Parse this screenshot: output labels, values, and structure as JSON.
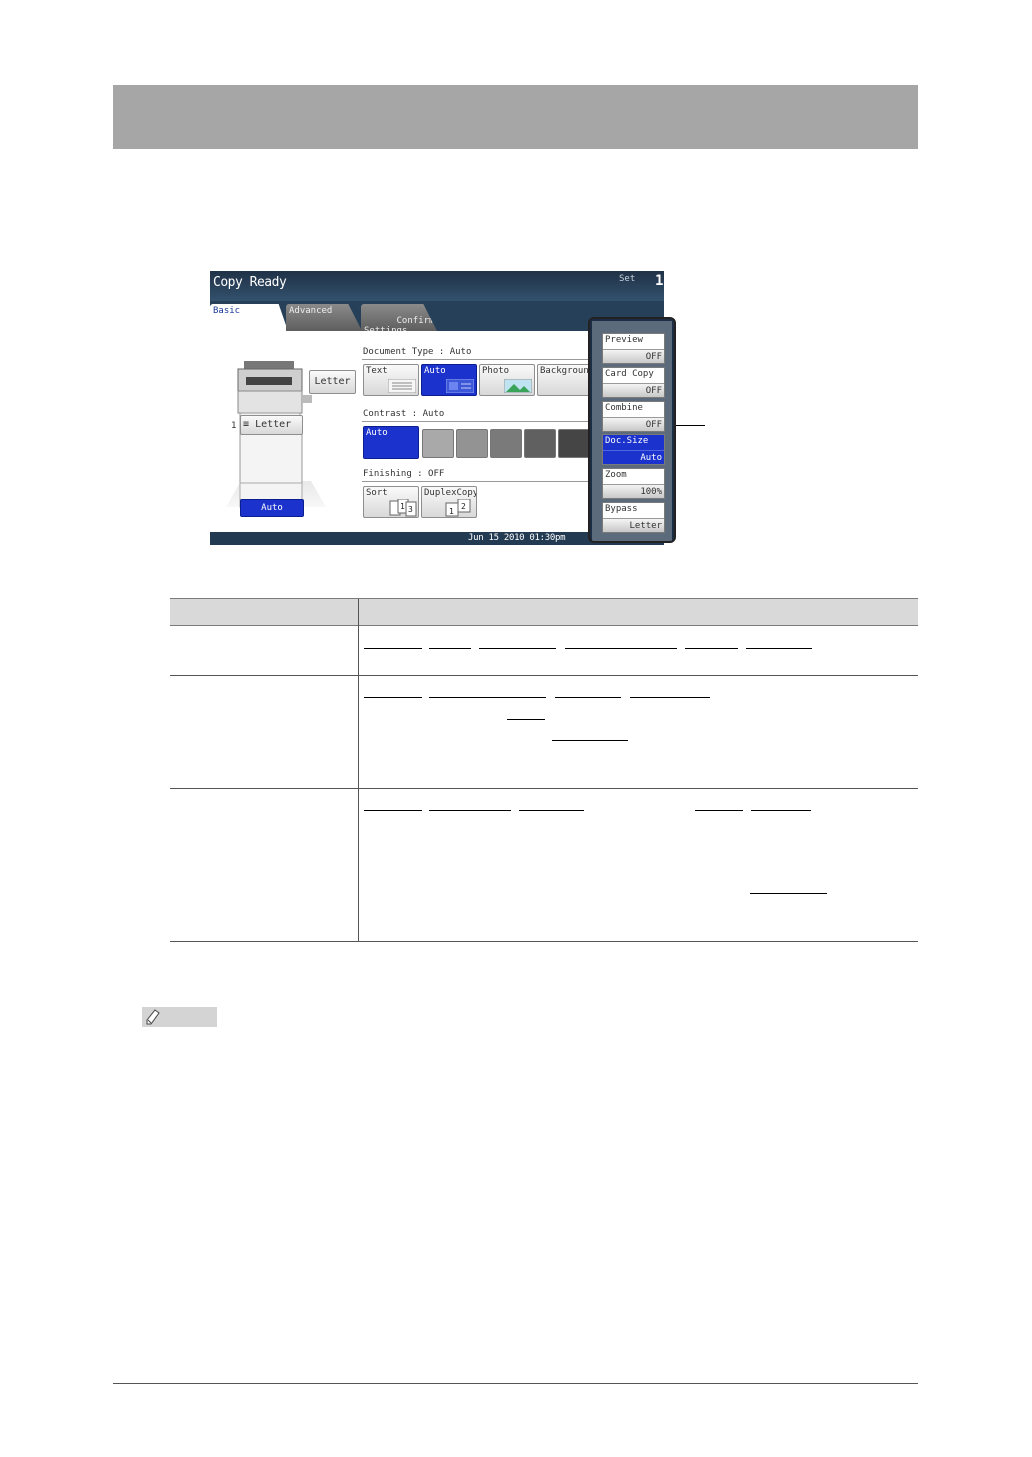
{
  "screen": {
    "title": "Copy Ready",
    "set_label": "Set",
    "set_count": "1",
    "tabs": [
      {
        "label": "Basic"
      },
      {
        "label": "Advanced"
      },
      {
        "label": "Confirm\nSettings"
      }
    ],
    "paper_tray_label": "Letter",
    "tray1_number": "1",
    "tray1_label": "Letter",
    "auto_button": "Auto",
    "document_type": {
      "label": "Document Type : Auto",
      "options": [
        "Text",
        "Auto",
        "Photo",
        "Background"
      ],
      "selected": "Auto"
    },
    "contrast": {
      "label": "Contrast     : Auto",
      "auto_label": "Auto",
      "levels": 5
    },
    "finishing": {
      "label": "Finishing    : OFF",
      "options": [
        "Sort",
        "DuplexCopy"
      ]
    },
    "side_panel": [
      {
        "name": "Preview",
        "value": "OFF",
        "selected": false
      },
      {
        "name": "Card Copy",
        "value": "OFF",
        "selected": false
      },
      {
        "name": "Combine",
        "value": "OFF",
        "selected": false
      },
      {
        "name": "Doc.Size",
        "value": "Auto",
        "selected": true
      },
      {
        "name": "Zoom",
        "value": "100%",
        "selected": false
      },
      {
        "name": "Bypass",
        "value": "Letter",
        "selected": false
      }
    ],
    "datetime": "Jun 15 2010 01:30pm"
  },
  "colors": {
    "header_bar": "#a6a6a6",
    "title_bar": "#1f3146",
    "selected_blue": "#1b33cc",
    "table_header": "#d9d9d9"
  },
  "icons": [
    "pencil-icon",
    "copier-icon",
    "text-doc-icon",
    "photo-doc-icon",
    "sort-icon",
    "duplex-icon"
  ]
}
